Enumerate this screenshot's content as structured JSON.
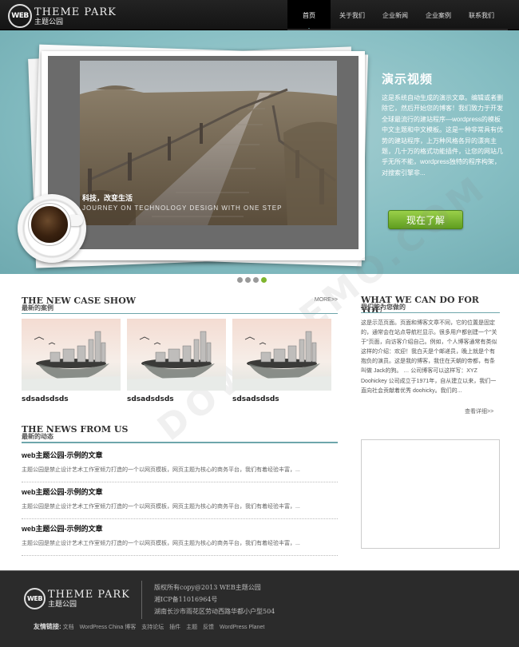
{
  "logo": {
    "badge": "WEB",
    "en": "HEME PARK",
    "t": "T",
    "cn": "主题公园"
  },
  "nav": [
    "首页",
    "关于我们",
    "企业新闻",
    "企业案例",
    "联系我们"
  ],
  "hero": {
    "caption_cn": "科技，改变生活",
    "caption_en": "JOURNEY ON TECHNOLOGY DESIGN WITH ONE STEP",
    "promo_title": "演示视频",
    "promo_text": "这是系统自动生成的演示文章。编辑或者删除它，然后开始您的博客！我们致力于开发全球最流行的建站程序—wordpress的模板中文主题和中文模板。这是一种非常具有优势的建站程序，上万种风格各异的漂亮主题，几十万的格式功能插件，让您的网站几乎无所不能，wordpress独特的程序构架，对搜索引擎非...",
    "promo_button": "现在了解"
  },
  "case_show": {
    "title": "THE NEW CASE SHOW",
    "subtitle": "最新的案例",
    "more": "MORE>>",
    "items": [
      "sdsadsdsds",
      "sdsadsdsds",
      "sdsadsdsds"
    ]
  },
  "news": {
    "title": "THE NEWS FROM US",
    "subtitle": "最新的动态",
    "items": [
      {
        "title": "web主题公园-示例的文章",
        "desc": "主题公园是禁止设计艺术工作室倾力打造的一个以网页模板，网页主题为核心的商务平台，我们有着经验丰富，..."
      },
      {
        "title": "web主题公园-示例的文章",
        "desc": "主题公园是禁止设计艺术工作室倾力打造的一个以网页模板，网页主题为核心的商务平台，我们有着经验丰富，..."
      },
      {
        "title": "web主题公园-示例的文章",
        "desc": "主题公园是禁止设计艺术工作室倾力打造的一个以网页模板，网页主题为核心的商务平台，我们有着经验丰富，..."
      }
    ]
  },
  "what": {
    "title": "WHAT WE CAN DO FOR YOU",
    "subtitle": "我们能为您做的",
    "text": "这是示范页面。页面和博客文章不同，它的位置是固定的，通常会在站点导航栏显示。很多用户都创建一个\"关于\"页面，向访客介绍自己。例如，个人博客通常有类似这样的介绍：欢迎！我白天是个邮递员，晚上就是个有抱负的演员。这是我的博客，我住在天朝的帝都，有条叫做 Jack的狗。 … 公司博客可以这样写：XYZ Doohickey 公司成立于1971年，自从建立以来，我们一直向社会贡献着优秀 doohicky。我们的...",
    "detail": "查看详细>>"
  },
  "footer": {
    "copyright": "版权所有copy@2013 WEB主题公园",
    "icp": "湘ICP备11016964号",
    "address": "湖南长沙市雨花区劳动西路华都小户型504",
    "links_label": "友情链接:",
    "links": [
      "文档",
      "WordPress China 博客",
      "支持论坛",
      "插件",
      "主题",
      "反馈",
      "WordPress Planet"
    ]
  },
  "watermark": "DOWNDEMO.COM"
}
